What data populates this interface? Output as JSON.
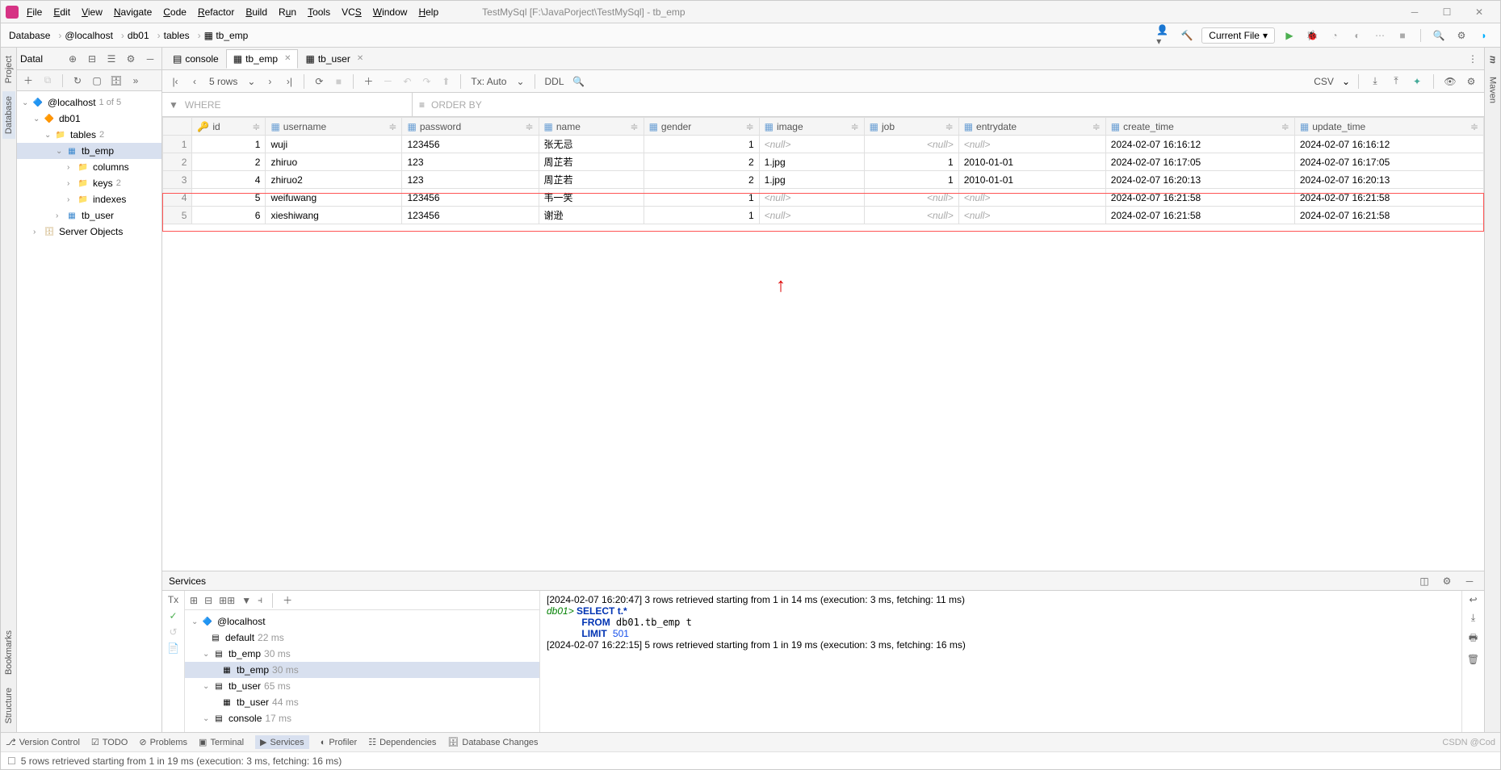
{
  "title": "TestMySql [F:\\JavaPorject\\TestMySql] - tb_emp",
  "menu": [
    "File",
    "Edit",
    "View",
    "Navigate",
    "Code",
    "Refactor",
    "Build",
    "Run",
    "Tools",
    "VCS",
    "Window",
    "Help"
  ],
  "breadcrumb": [
    "Database",
    "@localhost",
    "db01",
    "tables",
    "tb_emp"
  ],
  "run_config": "Current File",
  "db_sidebar_title": "Datal",
  "db_tree": {
    "host": "@localhost",
    "host_meta": "1 of 5",
    "schema": "db01",
    "tables_label": "tables",
    "tables_count": "2",
    "table1": "tb_emp",
    "table1_children": [
      "columns",
      "keys",
      "indexes"
    ],
    "keys_count": "2",
    "table2": "tb_user",
    "server_objects": "Server Objects"
  },
  "editor_tabs": [
    {
      "label": "console",
      "active": false
    },
    {
      "label": "tb_emp",
      "active": true
    },
    {
      "label": "tb_user",
      "active": false
    }
  ],
  "data_toolbar": {
    "rows_label": "5 rows",
    "tx_label": "Tx: Auto",
    "ddl_label": "DDL",
    "csv_label": "CSV"
  },
  "filter": {
    "where": "WHERE",
    "orderby": "ORDER BY"
  },
  "columns": [
    "id",
    "username",
    "password",
    "name",
    "gender",
    "image",
    "job",
    "entrydate",
    "create_time",
    "update_time"
  ],
  "rows": [
    {
      "n": "1",
      "id": "1",
      "username": "wuji",
      "password": "123456",
      "name": "张无忌",
      "gender": "1",
      "image": "<null>",
      "job": "<null>",
      "entrydate": "<null>",
      "create_time": "2024-02-07 16:16:12",
      "update_time": "2024-02-07 16:16:12"
    },
    {
      "n": "2",
      "id": "2",
      "username": "zhiruo",
      "password": "123",
      "name": "周芷若",
      "gender": "2",
      "image": "1.jpg",
      "job": "1",
      "entrydate": "2010-01-01",
      "create_time": "2024-02-07 16:17:05",
      "update_time": "2024-02-07 16:17:05"
    },
    {
      "n": "3",
      "id": "4",
      "username": "zhiruo2",
      "password": "123",
      "name": "周芷若",
      "gender": "2",
      "image": "1.jpg",
      "job": "1",
      "entrydate": "2010-01-01",
      "create_time": "2024-02-07 16:20:13",
      "update_time": "2024-02-07 16:20:13"
    },
    {
      "n": "4",
      "id": "5",
      "username": "weifuwang",
      "password": "123456",
      "name": "韦一笑",
      "gender": "1",
      "image": "<null>",
      "job": "<null>",
      "entrydate": "<null>",
      "create_time": "2024-02-07 16:21:58",
      "update_time": "2024-02-07 16:21:58"
    },
    {
      "n": "5",
      "id": "6",
      "username": "xieshiwang",
      "password": "123456",
      "name": "谢逊",
      "gender": "1",
      "image": "<null>",
      "job": "<null>",
      "entrydate": "<null>",
      "create_time": "2024-02-07 16:21:58",
      "update_time": "2024-02-07 16:21:58"
    }
  ],
  "services": {
    "title": "Services",
    "tree": {
      "host": "@localhost",
      "default": "default",
      "default_ms": "22 ms",
      "tb_emp": "tb_emp",
      "tb_emp_ms": "30 ms",
      "tb_emp_inner": "tb_emp",
      "tb_emp_inner_ms": "30 ms",
      "tb_user": "tb_user",
      "tb_user_ms": "65 ms",
      "tb_user_inner": "tb_user",
      "tb_user_inner_ms": "44 ms",
      "console": "console",
      "console_ms": "17 ms"
    },
    "log": {
      "l1": "[2024-02-07 16:20:47] 3 rows retrieved starting from 1 in 14 ms (execution: 3 ms, fetching: 11 ms)",
      "prompt": "db01>",
      "sql1": " SELECT t.*",
      "sql2": "FROM db01.tb_emp t",
      "sql3": "LIMIT 501",
      "l2": "[2024-02-07 16:22:15] 5 rows retrieved starting from 1 in 19 ms (execution: 3 ms, fetching: 16 ms)"
    }
  },
  "bottom_tools": [
    "Version Control",
    "TODO",
    "Problems",
    "Terminal",
    "Services",
    "Profiler",
    "Dependencies",
    "Database Changes"
  ],
  "status_text": "5 rows retrieved starting from 1 in 19 ms (execution: 3 ms, fetching: 16 ms)",
  "watermark": "CSDN @Cod",
  "left_tabs": [
    "Project",
    "Database",
    "Bookmarks",
    "Structure"
  ],
  "right_tab": "Maven"
}
